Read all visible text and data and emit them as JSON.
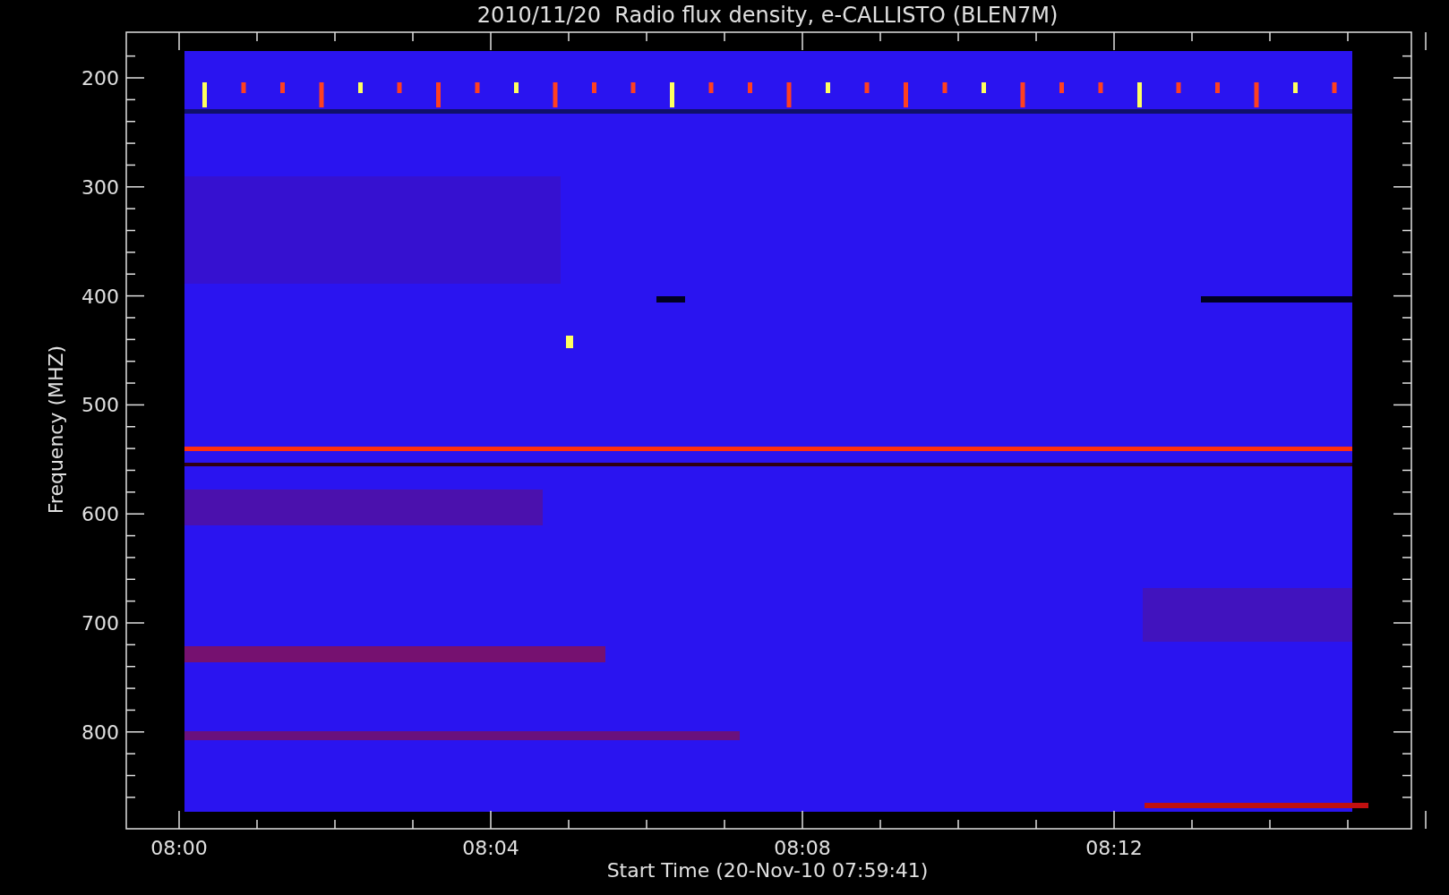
{
  "plot": {
    "title": "2010/11/20  Radio flux density, e-CALLISTO (BLEN7M)",
    "xlabel": "Start Time (20-Nov-10 07:59:41)",
    "ylabel": "Frequency (MHZ)",
    "y_tick_labels": [
      "200",
      "300",
      "400",
      "500",
      "600",
      "700",
      "800"
    ],
    "x_tick_labels": [
      "08:00",
      "08:04",
      "08:08",
      "08:12"
    ]
  }
}
